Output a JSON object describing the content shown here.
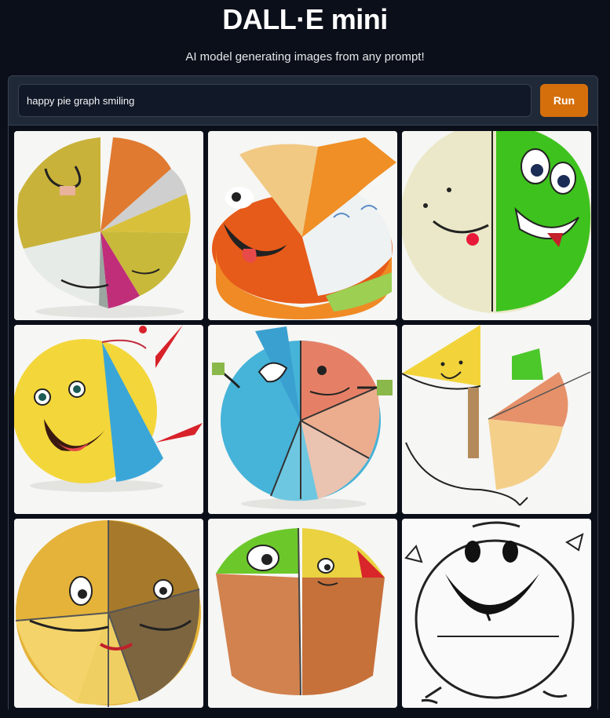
{
  "app": {
    "title": "DALL·E mini",
    "subtitle": "AI model generating images from any prompt!"
  },
  "prompt": {
    "value": "happy pie graph smiling"
  },
  "run_button": {
    "label": "Run"
  },
  "gallery": {
    "images": [
      {
        "name": "generated-image-1"
      },
      {
        "name": "generated-image-2"
      },
      {
        "name": "generated-image-3"
      },
      {
        "name": "generated-image-4"
      },
      {
        "name": "generated-image-5"
      },
      {
        "name": "generated-image-6"
      },
      {
        "name": "generated-image-7"
      },
      {
        "name": "generated-image-8"
      },
      {
        "name": "generated-image-9"
      }
    ]
  },
  "colors": {
    "background": "#0b0f19",
    "panel": "#1f2937",
    "input_bg": "#111827",
    "accent": "#d56f0b"
  }
}
